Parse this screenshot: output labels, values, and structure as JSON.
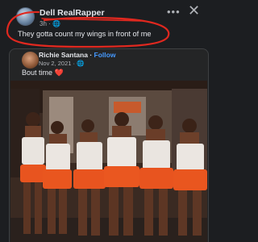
{
  "post": {
    "author": "Dell RealRapper",
    "meta": "3h · 🌐",
    "text": "They gotta count my wings in front of me",
    "more_icon": "more-options-icon",
    "close_icon": "close-icon"
  },
  "shared_post": {
    "author": "Richie Santana",
    "follow_label": "Follow",
    "date": "Nov 2, 2021 · 🌐",
    "text": "Bout time ",
    "emoji": "❤️",
    "photo_alt": "Photo"
  },
  "colors": {
    "background": "#1c1e21",
    "link": "#4599ff",
    "highlight_scribble": "#e0281f"
  }
}
